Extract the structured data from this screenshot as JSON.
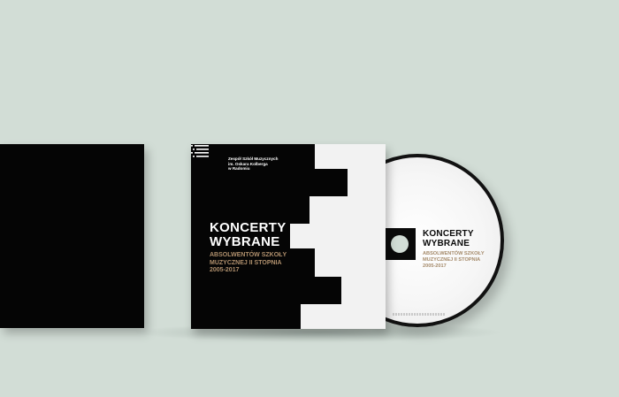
{
  "cover": {
    "school_line1": "Zespół Szkół Muzycznych",
    "school_line2": "im. Oskara Kolberga",
    "school_line3": "w Radomiu",
    "title_line1": "KONCERTY",
    "title_line2": "WYBRANE",
    "subtitle_line1": "ABSOLWENTÓW SZKOŁY",
    "subtitle_line2": "MUZYCZNEJ II STOPNIA",
    "years": "2005-2017"
  },
  "disc": {
    "title_line1": "KONCERTY",
    "title_line2": "WYBRANE",
    "subtitle_line1": "ABSOLWENTÓW SZKOŁY",
    "subtitle_line2": "MUZYCZNEJ II STOPNIA",
    "years": "2005-2017"
  },
  "colors": {
    "background": "#d2ddd6",
    "black": "#050505",
    "white": "#f2f2f2",
    "accent_gold": "#b0906d"
  }
}
